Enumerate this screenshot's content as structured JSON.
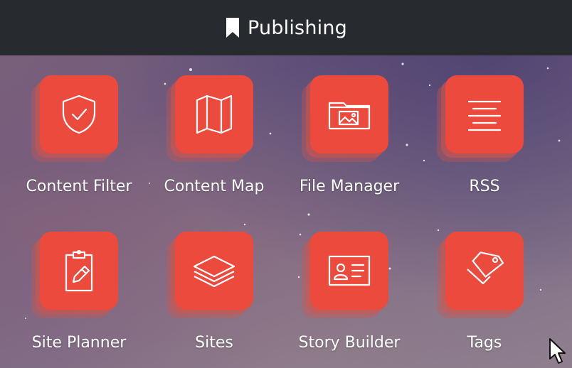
{
  "header": {
    "title": "Publishing",
    "icon": "bookmark-icon"
  },
  "apps": [
    {
      "label": "Content Filter",
      "icon": "shield-check-icon"
    },
    {
      "label": "Content Map",
      "icon": "map-icon"
    },
    {
      "label": "File Manager",
      "icon": "image-folder-icon"
    },
    {
      "label": "RSS",
      "icon": "align-center-lines-icon"
    },
    {
      "label": "Site Planner",
      "icon": "clipboard-pencil-icon"
    },
    {
      "label": "Sites",
      "icon": "layers-icon"
    },
    {
      "label": "Story Builder",
      "icon": "id-card-icon"
    },
    {
      "label": "Tags",
      "icon": "tags-icon"
    }
  ],
  "colors": {
    "header_bg": "#272a2e",
    "tile": "#ec4a3c",
    "text": "#ffffff"
  }
}
